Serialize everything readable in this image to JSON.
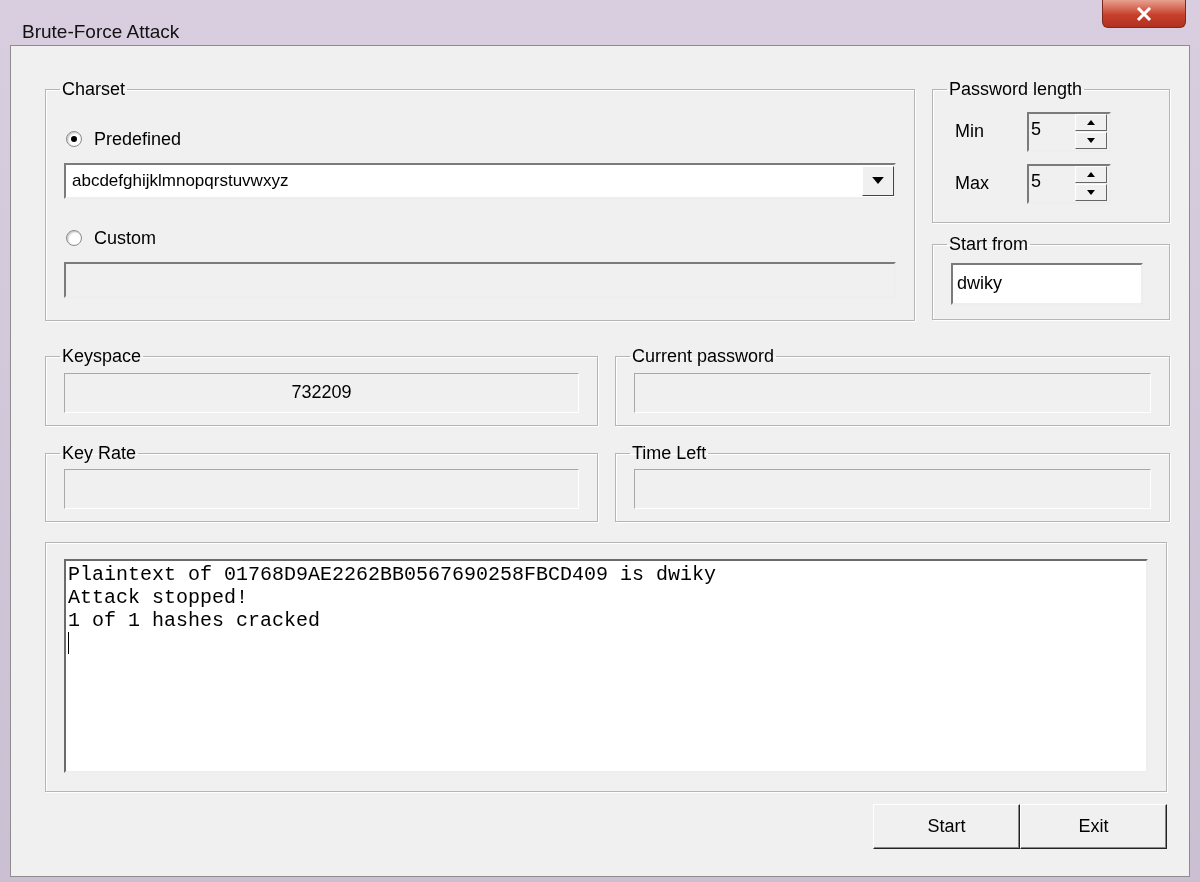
{
  "window": {
    "title": "Brute-Force Attack"
  },
  "charset": {
    "label": "Charset",
    "options": [
      {
        "label": "Predefined",
        "selected": true
      },
      {
        "label": "Custom",
        "selected": false
      }
    ],
    "predefined_value": "abcdefghijklmnopqrstuvwxyz",
    "custom_field": {
      "disabled": true
    }
  },
  "password_length": {
    "label": "Password length",
    "min": {
      "label": "Min",
      "value": "5"
    },
    "max": {
      "label": "Max",
      "value": "5"
    }
  },
  "start_from": {
    "label": "Start from",
    "value": "dwiky"
  },
  "stats": [
    {
      "label": "Keyspace",
      "value": "732209"
    },
    {
      "label": "Current password"
    },
    {
      "label": "Key Rate"
    },
    {
      "label": "Time Left"
    }
  ],
  "output": {
    "lines": [
      "Plaintext of 01768D9AE2262BB0567690258FBCD409 is dwiky",
      "Attack stopped!",
      "1 of 1 hashes cracked"
    ]
  },
  "buttons": [
    {
      "label": "Start"
    },
    {
      "label": "Exit"
    }
  ]
}
